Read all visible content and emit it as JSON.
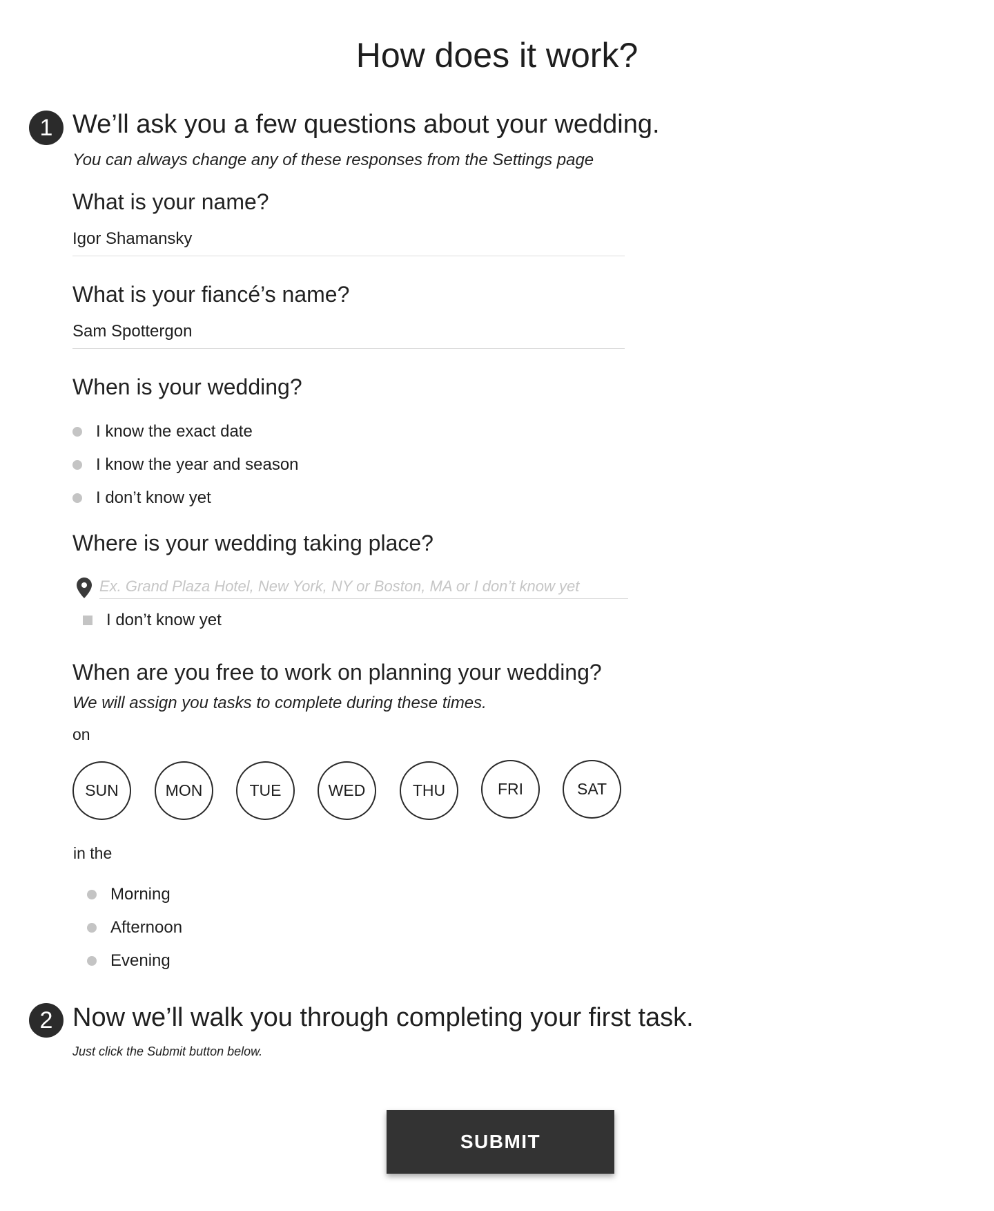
{
  "title": "How does it work?",
  "step1": {
    "number": "1",
    "heading": "We’ll ask you a few questions about your wedding.",
    "subheading": "You can always change any of these responses from the Settings page"
  },
  "name_question": {
    "label": "What is your name?",
    "value": "Igor Shamansky"
  },
  "fiance_question": {
    "label": "What is your fiancé’s name?",
    "value": "Sam Spottergon"
  },
  "date_question": {
    "label": "When is your wedding?",
    "options": [
      "I know the exact date",
      "I know the year and season",
      "I don’t know yet"
    ]
  },
  "location_question": {
    "label": "Where is your wedding taking place?",
    "placeholder": "Ex. Grand Plaza Hotel, New York, NY or Boston, MA or I don’t know yet",
    "checkbox_label": "I don’t know yet"
  },
  "availability": {
    "label": "When are you free to work on planning your wedding?",
    "sublabel": "We will assign you tasks to complete during these times.",
    "on_label": "on",
    "days": [
      "SUN",
      "MON",
      "TUE",
      "WED",
      "THU",
      "FRI",
      "SAT"
    ],
    "in_the_label": "in the",
    "times": [
      "Morning",
      "Afternoon",
      "Evening"
    ]
  },
  "step2": {
    "number": "2",
    "heading": "Now we’ll walk you through completing your first task.",
    "subheading": "Just click the Submit button below."
  },
  "submit_label": "SUBMIT",
  "icons": {
    "location": "map-pin-icon"
  },
  "colors": {
    "dark": "#2b2b2b",
    "muted_control": "#c4c4c4",
    "placeholder": "#c6c6c6"
  }
}
